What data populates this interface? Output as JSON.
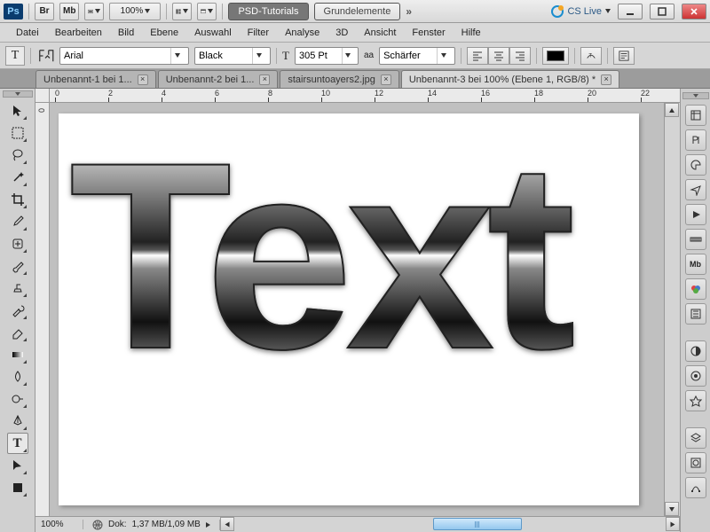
{
  "app": {
    "logo": "Ps",
    "zoom": "100%",
    "workspace1": "PSD-Tutorials",
    "workspace2": "Grundelemente",
    "cslive": "CS Live"
  },
  "topbuttons": {
    "br": "Br",
    "mb": "Mb"
  },
  "menu": {
    "items": [
      "Datei",
      "Bearbeiten",
      "Bild",
      "Ebene",
      "Auswahl",
      "Filter",
      "Analyse",
      "3D",
      "Ansicht",
      "Fenster",
      "Hilfe"
    ]
  },
  "options": {
    "font": "Arial",
    "weight": "Black",
    "size": "305 Pt",
    "aa_prefix": "aa",
    "aa": "Schärfer",
    "size_icon": "T"
  },
  "tabs": [
    {
      "label": "Unbenannt-1 bei 1...",
      "active": false
    },
    {
      "label": "Unbenannt-2 bei 1...",
      "active": false
    },
    {
      "label": "stairsuntoayers2.jpg",
      "active": false
    },
    {
      "label": "Unbenannt-3 bei 100% (Ebene 1, RGB/8) *",
      "active": true
    }
  ],
  "hruler": [
    "0",
    "2",
    "4",
    "6",
    "8",
    "10",
    "12",
    "14",
    "16",
    "18",
    "20",
    "22"
  ],
  "vruler": [
    "0"
  ],
  "status": {
    "zoom": "100%",
    "doc_label": "Dok:",
    "doc": "1,37 MB/1,09 MB"
  },
  "canvas_text": "Text",
  "tools": [
    "move",
    "marquee",
    "lasso",
    "wand",
    "crop",
    "eyedropper",
    "heal",
    "brush",
    "stamp",
    "history",
    "eraser",
    "gradient",
    "blur",
    "dodge",
    "pen",
    "type",
    "path",
    "shape",
    "3d",
    "camera",
    "hand",
    "zoom"
  ],
  "panels": [
    "history",
    "char",
    "swatch",
    "nav",
    "play",
    "measure",
    "mb",
    "color",
    "adjust",
    "sep",
    "mask",
    "brush",
    "clone",
    "sep",
    "layers",
    "channels",
    "paths"
  ]
}
